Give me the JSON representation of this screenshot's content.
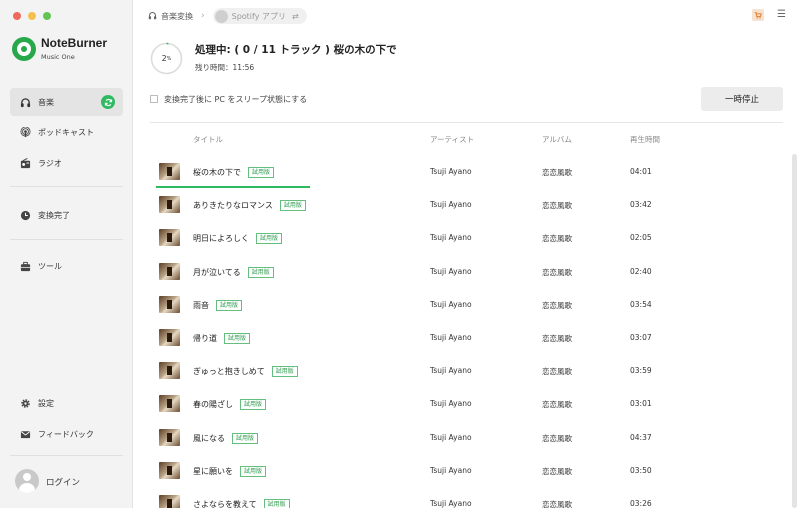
{
  "app": {
    "name": "NoteBurner",
    "subtitle": "Music One"
  },
  "colors": {
    "accent": "#2fba62",
    "brand": "#27a84a",
    "close": "#ed6a5e",
    "minimize": "#f5bf4f",
    "maximize": "#61c554"
  },
  "sidebar": {
    "items": [
      {
        "label": "音楽",
        "icon": "headphones-icon",
        "active": true
      },
      {
        "label": "ポッドキャスト",
        "icon": "podcast-icon"
      },
      {
        "label": "ラジオ",
        "icon": "radio-icon"
      },
      {
        "label": "変換完了",
        "icon": "clock-icon"
      },
      {
        "label": "ツール",
        "icon": "toolbox-icon"
      },
      {
        "label": "設定",
        "icon": "gear-icon"
      },
      {
        "label": "フィードバック",
        "icon": "mail-icon"
      }
    ],
    "login_label": "ログイン"
  },
  "breadcrumb": {
    "first": "音楽変換",
    "second": "Spotify アプリ",
    "swap_glyph": "⇄"
  },
  "status": {
    "percent": "2",
    "percent_unit": "%",
    "progress_fraction": 0.02,
    "title": "処理中: ( 0 / 11 トラック ) 桜の木の下で",
    "remaining_label": "残り時間：",
    "remaining_value": "11:56"
  },
  "sleep_option": "変換完了後に PC をスリープ状態にする",
  "pause_button": "一時停止",
  "table": {
    "columns": [
      "タイトル",
      "アーティスト",
      "アルバム",
      "再生時間"
    ],
    "trial_badge": "試用版",
    "current_row_progress": 0.48,
    "rows": [
      {
        "title": "桜の木の下で",
        "artist": "Tsuji Ayano",
        "album": "恋恋風歌",
        "duration": "04:01"
      },
      {
        "title": "ありきたりなロマンス",
        "artist": "Tsuji Ayano",
        "album": "恋恋風歌",
        "duration": "03:42"
      },
      {
        "title": "明日によろしく",
        "artist": "Tsuji Ayano",
        "album": "恋恋風歌",
        "duration": "02:05"
      },
      {
        "title": "月が泣いてる",
        "artist": "Tsuji Ayano",
        "album": "恋恋風歌",
        "duration": "02:40"
      },
      {
        "title": "雨音",
        "artist": "Tsuji Ayano",
        "album": "恋恋風歌",
        "duration": "03:54"
      },
      {
        "title": "帰り道",
        "artist": "Tsuji Ayano",
        "album": "恋恋風歌",
        "duration": "03:07"
      },
      {
        "title": "ぎゅっと抱きしめて",
        "artist": "Tsuji Ayano",
        "album": "恋恋風歌",
        "duration": "03:59"
      },
      {
        "title": "春の陽ざし",
        "artist": "Tsuji Ayano",
        "album": "恋恋風歌",
        "duration": "03:01"
      },
      {
        "title": "風になる",
        "artist": "Tsuji Ayano",
        "album": "恋恋風歌",
        "duration": "04:37"
      },
      {
        "title": "星に願いを",
        "artist": "Tsuji Ayano",
        "album": "恋恋風歌",
        "duration": "03:50"
      },
      {
        "title": "さよならを教えて",
        "artist": "Tsuji Ayano",
        "album": "恋恋風歌",
        "duration": "03:26"
      }
    ]
  }
}
